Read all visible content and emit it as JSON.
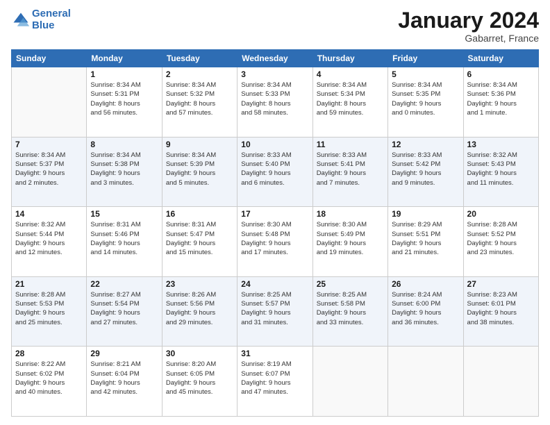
{
  "header": {
    "logo_line1": "General",
    "logo_line2": "Blue",
    "month_title": "January 2024",
    "location": "Gabarret, France"
  },
  "days_of_week": [
    "Sunday",
    "Monday",
    "Tuesday",
    "Wednesday",
    "Thursday",
    "Friday",
    "Saturday"
  ],
  "weeks": [
    [
      {
        "day": "",
        "info": ""
      },
      {
        "day": "1",
        "info": "Sunrise: 8:34 AM\nSunset: 5:31 PM\nDaylight: 8 hours\nand 56 minutes."
      },
      {
        "day": "2",
        "info": "Sunrise: 8:34 AM\nSunset: 5:32 PM\nDaylight: 8 hours\nand 57 minutes."
      },
      {
        "day": "3",
        "info": "Sunrise: 8:34 AM\nSunset: 5:33 PM\nDaylight: 8 hours\nand 58 minutes."
      },
      {
        "day": "4",
        "info": "Sunrise: 8:34 AM\nSunset: 5:34 PM\nDaylight: 8 hours\nand 59 minutes."
      },
      {
        "day": "5",
        "info": "Sunrise: 8:34 AM\nSunset: 5:35 PM\nDaylight: 9 hours\nand 0 minutes."
      },
      {
        "day": "6",
        "info": "Sunrise: 8:34 AM\nSunset: 5:36 PM\nDaylight: 9 hours\nand 1 minute."
      }
    ],
    [
      {
        "day": "7",
        "info": "Sunrise: 8:34 AM\nSunset: 5:37 PM\nDaylight: 9 hours\nand 2 minutes."
      },
      {
        "day": "8",
        "info": "Sunrise: 8:34 AM\nSunset: 5:38 PM\nDaylight: 9 hours\nand 3 minutes."
      },
      {
        "day": "9",
        "info": "Sunrise: 8:34 AM\nSunset: 5:39 PM\nDaylight: 9 hours\nand 5 minutes."
      },
      {
        "day": "10",
        "info": "Sunrise: 8:33 AM\nSunset: 5:40 PM\nDaylight: 9 hours\nand 6 minutes."
      },
      {
        "day": "11",
        "info": "Sunrise: 8:33 AM\nSunset: 5:41 PM\nDaylight: 9 hours\nand 7 minutes."
      },
      {
        "day": "12",
        "info": "Sunrise: 8:33 AM\nSunset: 5:42 PM\nDaylight: 9 hours\nand 9 minutes."
      },
      {
        "day": "13",
        "info": "Sunrise: 8:32 AM\nSunset: 5:43 PM\nDaylight: 9 hours\nand 11 minutes."
      }
    ],
    [
      {
        "day": "14",
        "info": "Sunrise: 8:32 AM\nSunset: 5:44 PM\nDaylight: 9 hours\nand 12 minutes."
      },
      {
        "day": "15",
        "info": "Sunrise: 8:31 AM\nSunset: 5:46 PM\nDaylight: 9 hours\nand 14 minutes."
      },
      {
        "day": "16",
        "info": "Sunrise: 8:31 AM\nSunset: 5:47 PM\nDaylight: 9 hours\nand 15 minutes."
      },
      {
        "day": "17",
        "info": "Sunrise: 8:30 AM\nSunset: 5:48 PM\nDaylight: 9 hours\nand 17 minutes."
      },
      {
        "day": "18",
        "info": "Sunrise: 8:30 AM\nSunset: 5:49 PM\nDaylight: 9 hours\nand 19 minutes."
      },
      {
        "day": "19",
        "info": "Sunrise: 8:29 AM\nSunset: 5:51 PM\nDaylight: 9 hours\nand 21 minutes."
      },
      {
        "day": "20",
        "info": "Sunrise: 8:28 AM\nSunset: 5:52 PM\nDaylight: 9 hours\nand 23 minutes."
      }
    ],
    [
      {
        "day": "21",
        "info": "Sunrise: 8:28 AM\nSunset: 5:53 PM\nDaylight: 9 hours\nand 25 minutes."
      },
      {
        "day": "22",
        "info": "Sunrise: 8:27 AM\nSunset: 5:54 PM\nDaylight: 9 hours\nand 27 minutes."
      },
      {
        "day": "23",
        "info": "Sunrise: 8:26 AM\nSunset: 5:56 PM\nDaylight: 9 hours\nand 29 minutes."
      },
      {
        "day": "24",
        "info": "Sunrise: 8:25 AM\nSunset: 5:57 PM\nDaylight: 9 hours\nand 31 minutes."
      },
      {
        "day": "25",
        "info": "Sunrise: 8:25 AM\nSunset: 5:58 PM\nDaylight: 9 hours\nand 33 minutes."
      },
      {
        "day": "26",
        "info": "Sunrise: 8:24 AM\nSunset: 6:00 PM\nDaylight: 9 hours\nand 36 minutes."
      },
      {
        "day": "27",
        "info": "Sunrise: 8:23 AM\nSunset: 6:01 PM\nDaylight: 9 hours\nand 38 minutes."
      }
    ],
    [
      {
        "day": "28",
        "info": "Sunrise: 8:22 AM\nSunset: 6:02 PM\nDaylight: 9 hours\nand 40 minutes."
      },
      {
        "day": "29",
        "info": "Sunrise: 8:21 AM\nSunset: 6:04 PM\nDaylight: 9 hours\nand 42 minutes."
      },
      {
        "day": "30",
        "info": "Sunrise: 8:20 AM\nSunset: 6:05 PM\nDaylight: 9 hours\nand 45 minutes."
      },
      {
        "day": "31",
        "info": "Sunrise: 8:19 AM\nSunset: 6:07 PM\nDaylight: 9 hours\nand 47 minutes."
      },
      {
        "day": "",
        "info": ""
      },
      {
        "day": "",
        "info": ""
      },
      {
        "day": "",
        "info": ""
      }
    ]
  ]
}
